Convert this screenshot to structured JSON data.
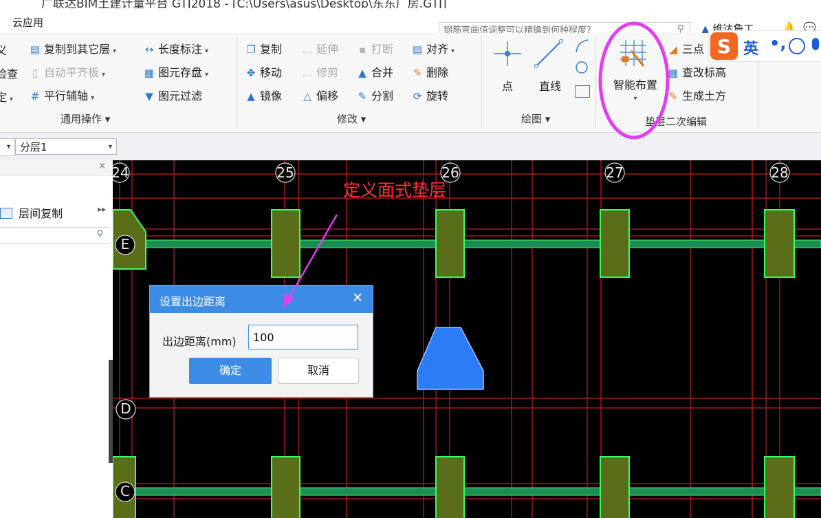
{
  "window": {
    "title": "广联达BIM土建计量平台 GTJ2018 - [C:\\Users\\asus\\Desktop\\东东厂房.GTJ]"
  },
  "menu": {
    "cloud_app": "云应用"
  },
  "search": {
    "placeholder": "钢筋弯曲值调整可以精确到何种程度?"
  },
  "brand": {
    "name": "维达詹工"
  },
  "ribbon": {
    "groups": {
      "general": {
        "label": "通用操作",
        "items": {
          "edge_a": "义",
          "edge_b": "检查",
          "edge_c": "定",
          "copy_to_layer": "复制到其它层",
          "auto_align_slab": "自动平齐板",
          "parallel_axis": "平行辅轴",
          "length_dim": "长度标注",
          "element_storage": "图元存盘",
          "element_filter": "图元过滤"
        }
      },
      "modify": {
        "label": "修改",
        "items": {
          "copy": "复制",
          "extend": "延伸",
          "break": "打断",
          "align": "对齐",
          "move": "移动",
          "trim": "修剪",
          "merge": "合并",
          "delete": "删除",
          "mirror": "镜像",
          "offset": "偏移",
          "split": "分割",
          "rotate": "旋转"
        }
      },
      "draw": {
        "label": "绘图",
        "items": {
          "point": "点",
          "line": "直线"
        }
      },
      "cushion": {
        "label": "垫层二次编辑",
        "items": {
          "smart_layout": "智能布置",
          "three_point": "三点",
          "edit_elevation": "查改标高",
          "gen_earthwork": "生成土方"
        }
      }
    }
  },
  "ime": {
    "lang": "英",
    "punct": "•,"
  },
  "floorbar": {
    "floor_select": "分层1"
  },
  "left_panel": {
    "copy_between_floors": "层间复制"
  },
  "canvas": {
    "axes": {
      "columns": [
        "24",
        "25",
        "26",
        "27",
        "28"
      ],
      "rows": [
        "E",
        "D",
        "C"
      ]
    },
    "annotation": "定义面式垫层"
  },
  "dialog": {
    "title": "设置出边距离",
    "label": "出边距离(mm)",
    "value": "100",
    "ok": "确定",
    "cancel": "取消"
  },
  "colors": {
    "ribbon_bg": "#f7f7f7",
    "canvas_bg": "#000000",
    "grid_line": "#c81e1e",
    "beam_green": "#1e8c55",
    "footing_fill": "#5a6e1a",
    "footing_edge": "#32ff64",
    "selected_shape": "#2c7cf6",
    "dialog_title": "#3c8ce6",
    "annotation_red": "#ff3030",
    "highlight_magenta": "#e040f0"
  }
}
